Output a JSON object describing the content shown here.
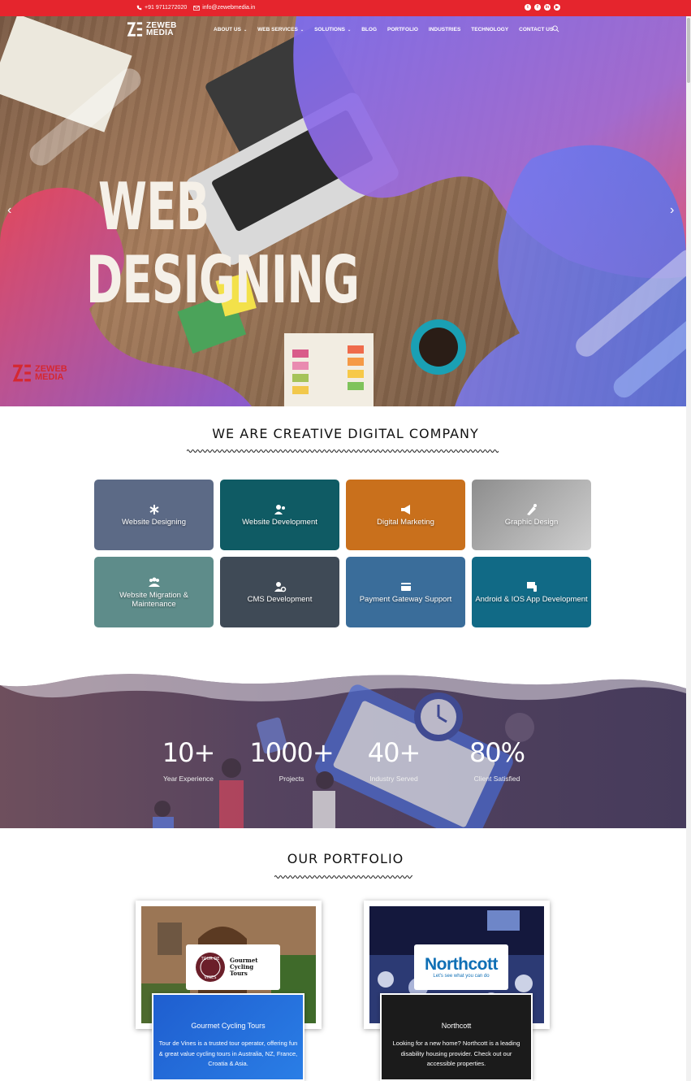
{
  "topbar": {
    "phone": "+91 9711272020",
    "email": "info@zewebmedia.in",
    "social_icons": [
      "twitter-icon",
      "facebook-icon",
      "linkedin-icon",
      "youtube-icon"
    ]
  },
  "brand": {
    "name_line1": "ZEWEB",
    "name_line2": "MEDIA",
    "red": "#e5252d"
  },
  "nav": {
    "items": [
      {
        "label": "ABOUT US",
        "dropdown": true
      },
      {
        "label": "WEB SERVICES",
        "dropdown": true
      },
      {
        "label": "SOLUTIONS",
        "dropdown": true
      },
      {
        "label": "BLOG",
        "dropdown": false
      },
      {
        "label": "PORTFOLIO",
        "dropdown": false
      },
      {
        "label": "INDUSTRIES",
        "dropdown": false
      },
      {
        "label": "TECHNOLOGY",
        "dropdown": false
      },
      {
        "label": "CONTACT US",
        "dropdown": false
      }
    ]
  },
  "hero": {
    "line1": "WEB",
    "line2": "DESIGNING",
    "prev": "‹",
    "next": "›"
  },
  "creative": {
    "title": "WE ARE CREATIVE DIGITAL COMPANY",
    "cards": [
      {
        "label": "Website Designing",
        "icon": "asterisk-icon",
        "bg": "#5c6a86"
      },
      {
        "label": "Website Development",
        "icon": "users-icon",
        "bg": "#0f5b64"
      },
      {
        "label": "Digital Marketing",
        "icon": "megaphone-icon",
        "bg": "#c9701c"
      },
      {
        "label": "Graphic Design",
        "icon": "design-icon",
        "bg": "#a8a8a8"
      },
      {
        "label": "Website Migration & Maintenance",
        "icon": "users-icon",
        "bg": "#5e8c8a"
      },
      {
        "label": "CMS Development",
        "icon": "user-gear-icon",
        "bg": "#3f4a56"
      },
      {
        "label": "Payment Gateway Support",
        "icon": "payment-icon",
        "bg": "#3a6d9a"
      },
      {
        "label": "Android & IOS App Development",
        "icon": "mobile-app-icon",
        "bg": "#116a86"
      }
    ]
  },
  "stats": [
    {
      "num": "10+",
      "label": "Year Experience"
    },
    {
      "num": "1000+",
      "label": "Projects"
    },
    {
      "num": "40+",
      "label": "Industry Served"
    },
    {
      "num": "80%",
      "label": "Client Satisfied"
    }
  ],
  "portfolio": {
    "title": "OUR PORTFOLIO",
    "items": [
      {
        "title": "Gourmet Cycling Tours",
        "desc": "Tour de Vines is a trusted tour operator, offering fun & great value cycling tours in Australia, NZ, France, Croatia & Asia.",
        "logo_name": "Gourmet Cycling Tours",
        "seal_top": "TOUR DE",
        "seal_bottom": "VINES"
      },
      {
        "title": "Northcott",
        "desc": "Looking for a new home? Northcott is a leading disability housing provider. Check out our accessible properties.",
        "logo_name": "Northcott",
        "logo_tagline": "Let's see what you can do"
      }
    ]
  }
}
